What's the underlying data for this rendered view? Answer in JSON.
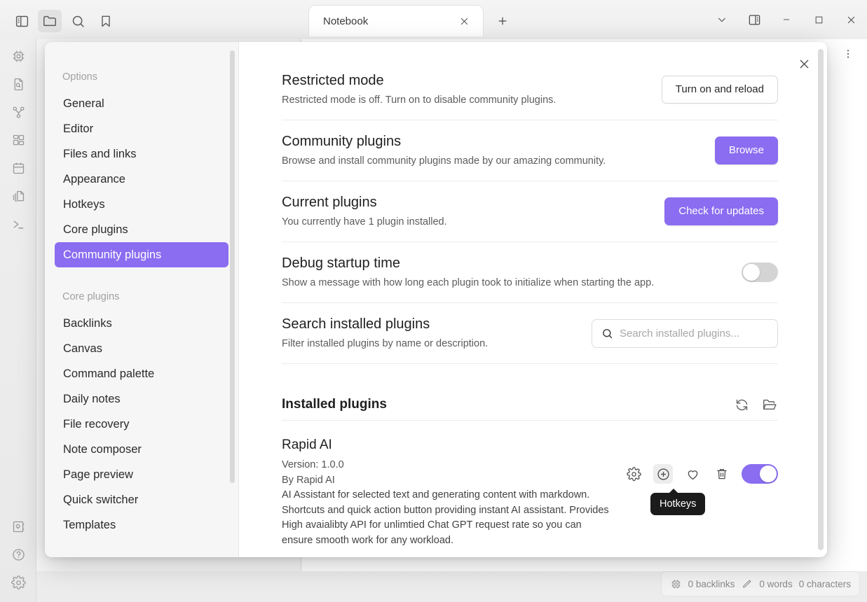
{
  "window": {
    "titlebar_icons": [
      {
        "name": "toggle-sidebar-icon",
        "label": "Toggle sidebar"
      },
      {
        "name": "folder-icon",
        "label": "Files"
      },
      {
        "name": "search-icon",
        "label": "Search"
      },
      {
        "name": "bookmark-icon",
        "label": "Bookmarks"
      }
    ],
    "controls": [
      {
        "name": "tab-list-dropdown",
        "label": "v"
      },
      {
        "name": "toggle-right-sidebar-icon",
        "label": "Right sidebar"
      },
      {
        "name": "minimize-button",
        "label": "–"
      },
      {
        "name": "maximize-button",
        "label": "□"
      },
      {
        "name": "close-button",
        "label": "✕"
      }
    ]
  },
  "tab": {
    "title": "Notebook",
    "close_label": "✕",
    "new_tab_label": "+"
  },
  "rail": {
    "top_icons": [
      "chip-icon",
      "file-search-icon",
      "graph-icon",
      "grid-icon",
      "calendar-icon",
      "copy-files-icon",
      "terminal-icon"
    ],
    "bottom_icons": [
      "vault-icon",
      "help-icon",
      "settings-gear-icon"
    ]
  },
  "editor_toolbar": {
    "icons": [
      "reading-view-icon",
      "more-options-icon"
    ]
  },
  "statusbar": {
    "chip_icon": "chip-icon",
    "backlinks": "0 backlinks",
    "pencil_icon": "pencil-icon",
    "words": "0 words",
    "characters": "0 characters"
  },
  "settings_modal": {
    "close_label": "✕",
    "sidebar": {
      "groups": [
        {
          "heading": "Options",
          "items": [
            {
              "label": "General",
              "selected": false
            },
            {
              "label": "Editor",
              "selected": false
            },
            {
              "label": "Files and links",
              "selected": false
            },
            {
              "label": "Appearance",
              "selected": false
            },
            {
              "label": "Hotkeys",
              "selected": false
            },
            {
              "label": "Core plugins",
              "selected": false
            },
            {
              "label": "Community plugins",
              "selected": true
            }
          ]
        },
        {
          "heading": "Core plugins",
          "items": [
            {
              "label": "Backlinks",
              "selected": false
            },
            {
              "label": "Canvas",
              "selected": false
            },
            {
              "label": "Command palette",
              "selected": false
            },
            {
              "label": "Daily notes",
              "selected": false
            },
            {
              "label": "File recovery",
              "selected": false
            },
            {
              "label": "Note composer",
              "selected": false
            },
            {
              "label": "Page preview",
              "selected": false
            },
            {
              "label": "Quick switcher",
              "selected": false
            },
            {
              "label": "Templates",
              "selected": false
            }
          ]
        }
      ]
    },
    "settings": {
      "restricted_mode": {
        "name": "Restricted mode",
        "desc": "Restricted mode is off. Turn on to disable community plugins.",
        "button": "Turn on and reload"
      },
      "community_plugins": {
        "name": "Community plugins",
        "desc": "Browse and install community plugins made by our amazing community.",
        "button": "Browse"
      },
      "current_plugins": {
        "name": "Current plugins",
        "desc": "You currently have 1 plugin installed.",
        "button": "Check for updates"
      },
      "debug_startup": {
        "name": "Debug startup time",
        "desc": "Show a message with how long each plugin took to initialize when starting the app.",
        "toggle_state": "off"
      },
      "search_plugins": {
        "name": "Search installed plugins",
        "desc": "Filter installed plugins by name or description.",
        "input_value": "",
        "placeholder": "Search installed plugins..."
      }
    },
    "installed_section": {
      "title": "Installed plugins",
      "actions": [
        "refresh-icon",
        "open-folder-icon"
      ]
    },
    "plugins": [
      {
        "name": "Rapid AI",
        "version": "Version: 1.0.0",
        "author": "By Rapid AI",
        "description": "AI Assistant for selected text and generating content with markdown. Shortcuts and quick action button providing instant AI assistant. Provides High avaialibty API for unlimtied Chat GPT request rate so you can ensure smooth work for any workload.",
        "actions": [
          {
            "name": "gear-icon",
            "hovered": false
          },
          {
            "name": "plus-circle-icon",
            "hovered": true
          },
          {
            "name": "heart-icon",
            "hovered": false
          },
          {
            "name": "trash-icon",
            "hovered": false
          }
        ],
        "toggle_state": "on",
        "tooltip": "Hotkeys"
      }
    ]
  },
  "colors": {
    "accent": "#8a6df0",
    "accent_text": "#ffffff",
    "tooltip_bg": "#1b1b1b"
  }
}
